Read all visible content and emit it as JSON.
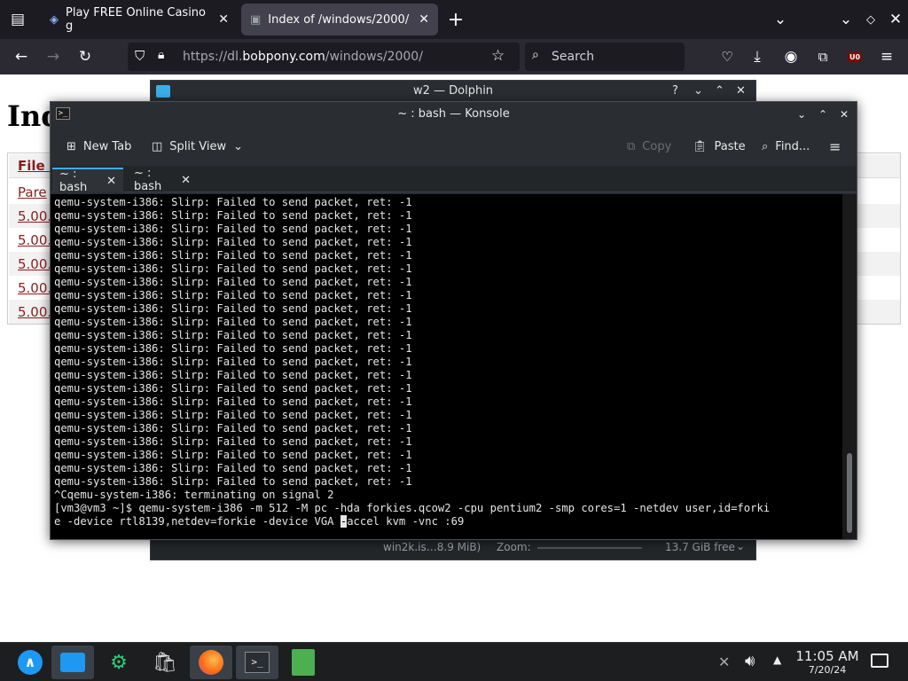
{
  "browser": {
    "tabs": [
      {
        "label": "Play FREE Online Casino g"
      },
      {
        "label": "Index of /windows/2000/"
      }
    ],
    "new_tab_label": "+",
    "url_prefix": "https://dl.",
    "url_domain": "bobpony.com",
    "url_path": "/windows/2000/",
    "search_placeholder": "Search",
    "ublock_badge": "U0"
  },
  "page": {
    "heading": "Ind",
    "table_header": "File N",
    "rows": [
      "Pare",
      "5.00.",
      "5.00.",
      "5.00.",
      "5.00.",
      "5.00."
    ]
  },
  "dolphin": {
    "title": "w2 — Dolphin",
    "status_file": "win2k.is…8.9 MiB)",
    "zoom_label": "Zoom:",
    "free_space": "13.7 GiB free"
  },
  "konsole": {
    "title": "~ : bash — Konsole",
    "toolbar": {
      "new_tab": "New Tab",
      "split_view": "Split View",
      "copy": "Copy",
      "paste": "Paste",
      "find": "Find..."
    },
    "tabs": [
      {
        "label": "~ : bash"
      },
      {
        "label": "~ : bash"
      }
    ],
    "terminal": {
      "repeated_line": "qemu-system-i386: Slirp: Failed to send packet, ret: -1",
      "repeat_count": 22,
      "signal_line": "^Cqemu-system-i386: terminating on signal 2",
      "prompt_line": "[vm3@vm3 ~]$ qemu-system-i386 -m 512 -M pc -hda forkies.qcow2 -cpu pentium2 -smp cores=1 -netdev user,id=forki",
      "wrap_start": "e -device rtl8139,netdev=forkie -device VGA ",
      "cursor_char": "-",
      "wrap_end": "accel kvm -vnc :69"
    }
  },
  "taskbar": {
    "time": "11:05 AM",
    "date": "7/20/24"
  },
  "colors": {
    "link": "#8b1e1e",
    "accent": "#3daee9",
    "terminal_bg": "#000000"
  }
}
